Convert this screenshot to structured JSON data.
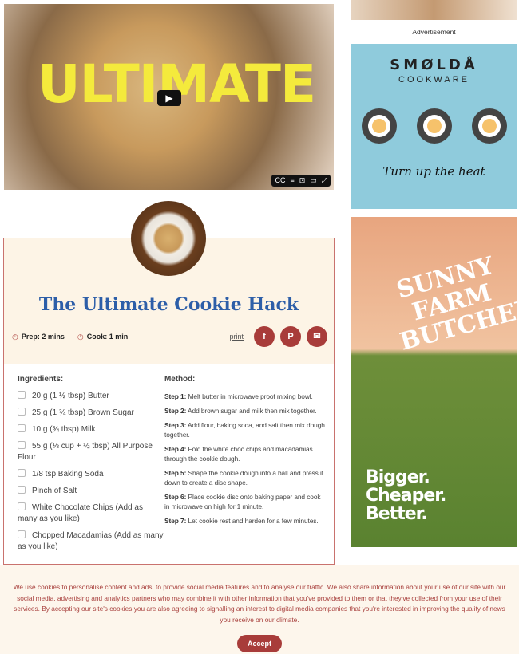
{
  "video": {
    "overlay_text": "ULTIMATE",
    "controls": [
      "CC",
      "≡",
      "⊡",
      "▭",
      "⤢"
    ]
  },
  "recipe": {
    "title": "The Ultimate Cookie Hack",
    "prep": "Prep: 2 mins",
    "cook": "Cook: 1 min",
    "print": "print",
    "ingredients_label": "Ingredients:",
    "method_label": "Method:",
    "ingredients": [
      "20 g (1 ½ tbsp) Butter",
      "25 g (1 ¾ tbsp) Brown Sugar",
      "10 g (¾ tbsp) Milk",
      "55 g (⅓ cup + ½ tbsp) All Purpose Flour",
      "1/8 tsp Baking Soda",
      "Pinch of Salt",
      "White Chocolate Chips (Add as many as you like)",
      "Chopped Macadamias (Add as many as you like)"
    ],
    "steps": [
      {
        "label": "Step 1:",
        "text": " Melt butter in microwave proof mixing bowl."
      },
      {
        "label": "Step 2:",
        "text": " Add brown sugar and milk then mix together."
      },
      {
        "label": "Step 3:",
        "text": " Add flour, baking soda, and salt then mix dough together."
      },
      {
        "label": "Step 4:",
        "text": " Fold the white choc chips and macadamias through the cookie dough."
      },
      {
        "label": "Step 5:",
        "text": " Shape the cookie dough into a ball and press it down to create a disc shape."
      },
      {
        "label": "Step 6:",
        "text": " Place cookie disc onto baking paper and cook in microwave on high for 1 minute."
      },
      {
        "label": "Step 7:",
        "text": " Let cookie rest and harden for a few minutes."
      }
    ]
  },
  "ads": {
    "label": "Advertisement",
    "ad1": {
      "brand": "SMØLDÅ",
      "sub": "COOKWARE",
      "tagline": "Turn up the heat"
    },
    "ad2": {
      "brand": "SUNNY FARM BUTCHERS",
      "slogan": [
        "Bigger.",
        "Cheaper.",
        "Better."
      ]
    }
  },
  "cookie": {
    "text": "We use cookies to personalise content and ads, to provide social media features and to analyse our traffic. We also share information about your use of our site with our social media, advertising and analytics partners who may combine it with other information that you've provided to them or that they've collected from your use of their services. By accepting our site's cookies you are also agreeing to signalling an interest to digital media companies that you're interested in improving the quality of news you receive on our climate.",
    "accept": "Accept"
  },
  "colors": {
    "accent": "#a83c3a",
    "title": "#2d5ea8",
    "card_bg": "#fdf4e6"
  }
}
